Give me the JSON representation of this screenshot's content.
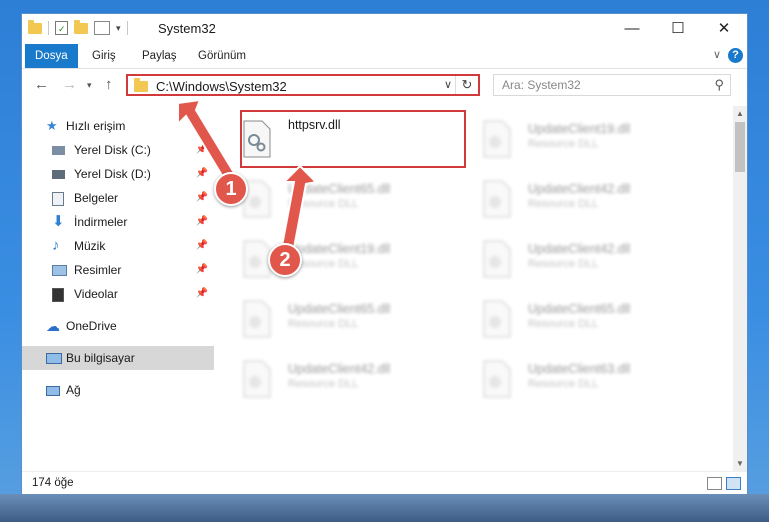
{
  "window": {
    "title": "System32",
    "minimize": "—",
    "maximize": "☐",
    "close": "✕"
  },
  "ribbon": {
    "tabs": [
      "Dosya",
      "Giriş",
      "Paylaş",
      "Görünüm"
    ],
    "help": "?"
  },
  "nav": {
    "address": "C:\\Windows\\System32",
    "search_placeholder": "Ara: System32"
  },
  "sidebar": {
    "items": [
      {
        "label": "Hızlı erişim"
      },
      {
        "label": "Yerel Disk (C:)"
      },
      {
        "label": "Yerel Disk (D:)"
      },
      {
        "label": "Belgeler"
      },
      {
        "label": "İndirmeler"
      },
      {
        "label": "Müzik"
      },
      {
        "label": "Resimler"
      },
      {
        "label": "Videolar"
      },
      {
        "label": "OneDrive"
      },
      {
        "label": "Bu bilgisayar"
      },
      {
        "label": "Ağ"
      }
    ]
  },
  "files": [
    {
      "name": "httpsrv.dll",
      "type": ""
    },
    {
      "name": "UpdateClient19.dll",
      "type": "Resource DLL"
    },
    {
      "name": "UpdateClient65.dll",
      "type": "Resource DLL"
    },
    {
      "name": "UpdateClient42.dll",
      "type": "Resource DLL"
    },
    {
      "name": "UpdateClient19.dll",
      "type": "Resource DLL"
    },
    {
      "name": "UpdateClient42.dll",
      "type": "Resource DLL"
    },
    {
      "name": "UpdateClient65.dll",
      "type": "Resource DLL"
    },
    {
      "name": "UpdateClient65.dll",
      "type": "Resource DLL"
    },
    {
      "name": "UpdateClient42.dll",
      "type": "Resource DLL"
    },
    {
      "name": "UpdateClient63.dll",
      "type": "Resource DLL"
    }
  ],
  "status": {
    "count": "174 öğe"
  },
  "annotations": {
    "step1": "1",
    "step2": "2"
  },
  "colors": {
    "accent": "#1979ca",
    "highlight": "#d23a3a",
    "badge": "#e2574c"
  }
}
